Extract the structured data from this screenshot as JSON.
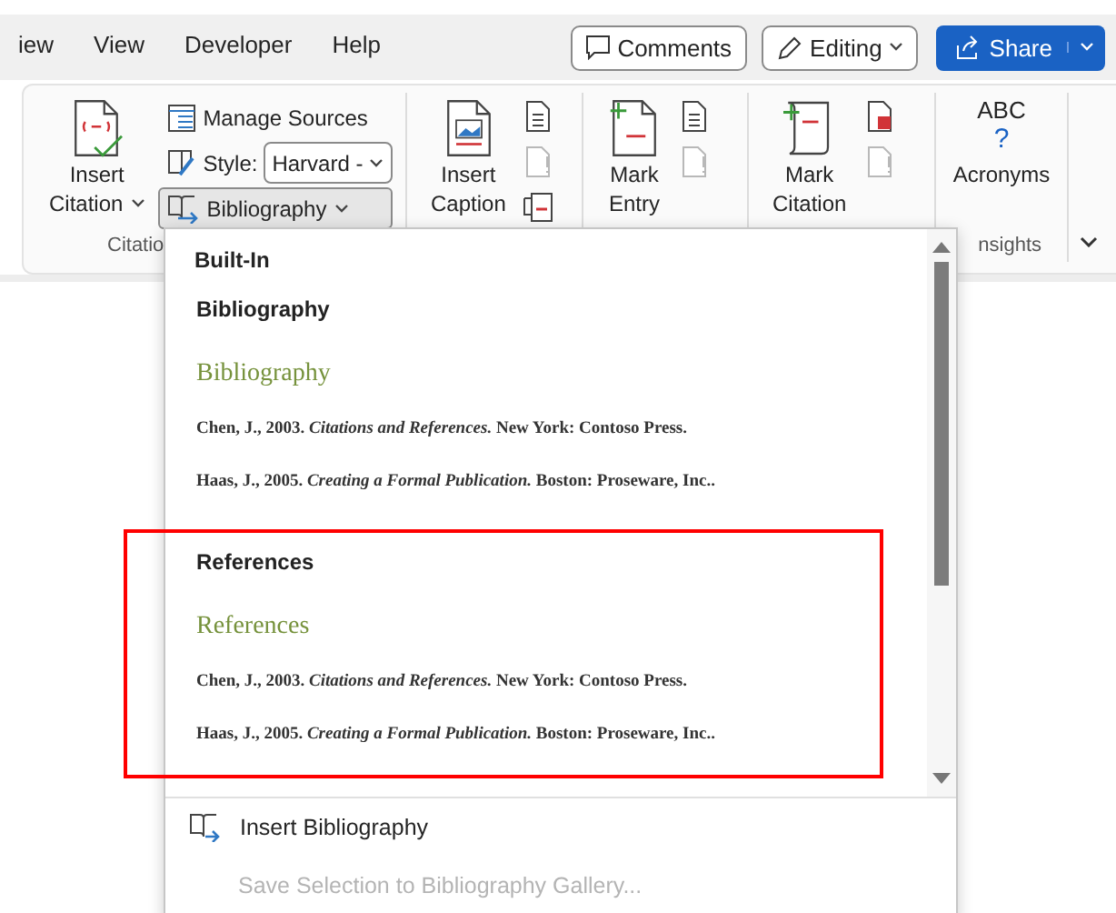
{
  "tabs": [
    {
      "label": "iew",
      "selected": false
    },
    {
      "label": "View",
      "selected": false
    },
    {
      "label": "Developer",
      "selected": false
    },
    {
      "label": "Help",
      "selected": false
    }
  ],
  "header_buttons": [
    {
      "kind": "comments",
      "label": "Comments"
    },
    {
      "kind": "editing",
      "label": "Editing"
    },
    {
      "kind": "share",
      "label": "Share"
    }
  ],
  "ribbon": {
    "citations": {
      "insert_citation": [
        "Insert",
        "Citation"
      ],
      "manage_sources": "Manage Sources",
      "style_label": "Style:",
      "style_value": "Harvard -",
      "bibliography": {
        "label": "Bibliography",
        "selected": true
      },
      "group_label": "Citatio"
    },
    "groups": [
      {
        "kind": "caption",
        "lines": [
          "Insert",
          "Caption"
        ],
        "small": [
          {
            "kind": "doc",
            "disabled": false
          },
          {
            "kind": "doc",
            "disabled": true
          },
          {
            "kind": "cross",
            "disabled": false
          }
        ]
      },
      {
        "kind": "entry",
        "lines": [
          "Mark",
          "Entry"
        ],
        "small": [
          {
            "kind": "doc",
            "disabled": false
          },
          {
            "kind": "doc",
            "disabled": true
          }
        ]
      },
      {
        "kind": "citation",
        "lines": [
          "Mark",
          "Citation"
        ],
        "small": [
          {
            "kind": "table",
            "disabled": false
          },
          {
            "kind": "doc",
            "disabled": true
          }
        ]
      },
      {
        "kind": "acronyms",
        "lines": [
          "Acronyms"
        ],
        "icon_text": [
          "ABC",
          "?"
        ],
        "group_label": "nsights"
      }
    ]
  },
  "dropdown": {
    "gallery_title": "Built-In",
    "entries": [
      {
        "heading": "Bibliography",
        "title": "Bibliography",
        "citations": [
          "Chen, J., 2003. *Citations and References.* New York: Contoso Press.",
          "Haas, J., 2005. *Creating a Formal Publication.* Boston: Proseware, Inc.."
        ]
      },
      {
        "heading": "References",
        "title": "References",
        "citations": [
          "Chen, J., 2003. *Citations and References.* New York: Contoso Press.",
          "Haas, J., 2005. *Creating a Formal Publication.* Boston: Proseware, Inc.."
        ]
      }
    ],
    "menu": [
      {
        "kind": "insert",
        "label": "Insert Bibliography",
        "disabled": false
      },
      {
        "kind": "save",
        "label": "Save Selection to Bibliography Gallery...",
        "disabled": true
      }
    ]
  }
}
